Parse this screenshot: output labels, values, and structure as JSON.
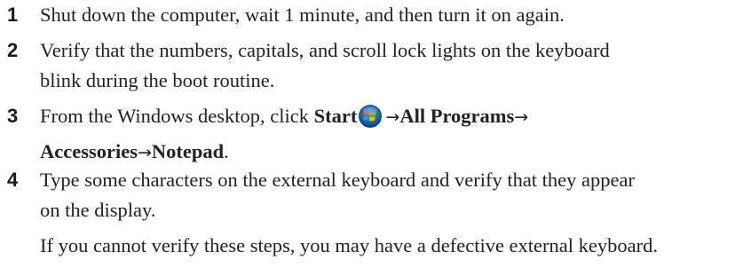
{
  "steps": [
    {
      "number": "1",
      "text": "Shut down the computer, wait 1 minute, and then turn it on again."
    },
    {
      "number": "2",
      "line1": "Verify that the numbers, capitals, and scroll lock lights on the keyboard",
      "line2": "blink during the boot routine."
    },
    {
      "number": "3",
      "intro": "From the Windows desktop, click ",
      "start": "Start",
      "arrow": "→",
      "all_programs": "All Programs",
      "accessories": "Accessories",
      "notepad": "Notepad",
      "end": "."
    },
    {
      "number": "4",
      "line1": "Type some characters on the external keyboard and verify that they appear",
      "line2": "on the display."
    }
  ],
  "note": "If you cannot verify these steps, you may have a defective external keyboard.",
  "icons": {
    "windows_logo": "windows-start-orb-icon"
  }
}
